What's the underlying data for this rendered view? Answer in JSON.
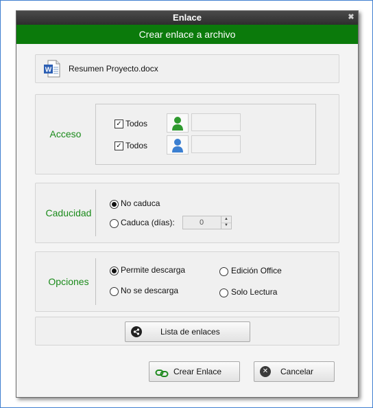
{
  "window": {
    "title": "Enlace",
    "close_glyph": "✖"
  },
  "banner": {
    "text": "Crear enlace a archivo"
  },
  "file": {
    "icon": "word-document-icon",
    "name": "Resumen Proyecto.docx",
    "badge": "W"
  },
  "acceso": {
    "label": "Acceso",
    "rows": [
      {
        "checked": true,
        "label": "Todos",
        "icon": "user-green-icon",
        "color": "#2f9a2f",
        "value": ""
      },
      {
        "checked": true,
        "label": "Todos",
        "icon": "user-blue-icon",
        "color": "#3b7fd1",
        "value": ""
      }
    ],
    "check_glyph": "✓"
  },
  "caducidad": {
    "label": "Caducidad",
    "options": [
      {
        "label": "No caduca",
        "selected": true
      },
      {
        "label": "Caduca (días):",
        "selected": false
      }
    ],
    "days_value": "0",
    "up_glyph": "▲",
    "down_glyph": "▼"
  },
  "opciones": {
    "label": "Opciones",
    "options": [
      {
        "label": "Permite descarga",
        "selected": true
      },
      {
        "label": "No se descarga",
        "selected": false
      },
      {
        "label": "Edición Office",
        "selected": false
      },
      {
        "label": "Solo Lectura",
        "selected": false
      }
    ]
  },
  "links_button": {
    "label": "Lista de enlaces",
    "icon": "share-icon"
  },
  "footer": {
    "create_label": "Crear Enlace",
    "create_icon": "link-icon",
    "create_color": "#1f8a1f",
    "cancel_label": "Cancelar",
    "cancel_icon": "cancel-icon",
    "cancel_glyph": "✕"
  },
  "colors": {
    "accent": "#0b7a0b",
    "label_green": "#1a8a1a",
    "titlebar": "#3a3a3a"
  }
}
